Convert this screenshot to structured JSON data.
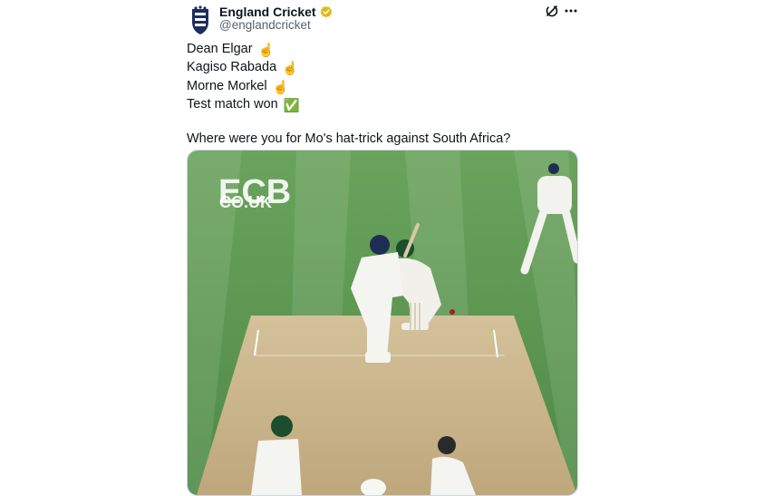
{
  "tweet": {
    "author": {
      "display_name": "England Cricket",
      "handle": "@englandcricket",
      "avatar_icon": "ecb-lions-crest-icon",
      "verified_icon": "gold-verified-badge-icon"
    },
    "actions": {
      "grok_icon": "grok-icon",
      "more_icon": "more-options-icon"
    },
    "lines": [
      {
        "text": "Dean Elgar",
        "emoji": "☝"
      },
      {
        "text": "Kagiso Rabada",
        "emoji": "☝"
      },
      {
        "text": "Morne Morkel",
        "emoji": "☝"
      },
      {
        "text": "Test match won",
        "emoji": "✅"
      }
    ],
    "question": "Where were you for Mo's hat-trick against South Africa?",
    "media": {
      "watermark_line1": "ECB",
      "watermark_line2": "CO.UK"
    }
  },
  "colors": {
    "text": "#0f1419",
    "secondary_text": "#536471",
    "verified_gold": "#e2b719",
    "grass": "#5f9a55",
    "pitch": "#c9b38a"
  }
}
